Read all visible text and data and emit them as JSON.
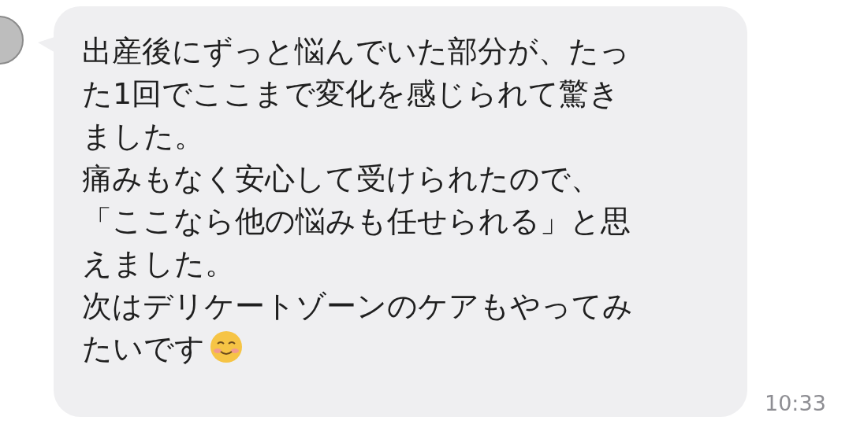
{
  "message": {
    "lines": [
      "出産後にずっと悩んでいた部分が、たっ",
      "た1回でここまで変化を感じられて驚き",
      "ました。",
      "痛みもなく安心して受けられたので、",
      "「ここなら他の悩みも任せられる」と思",
      "えました。",
      "次はデリケートゾーンのケアもやってみ",
      "たいです"
    ],
    "time": "10:33"
  }
}
